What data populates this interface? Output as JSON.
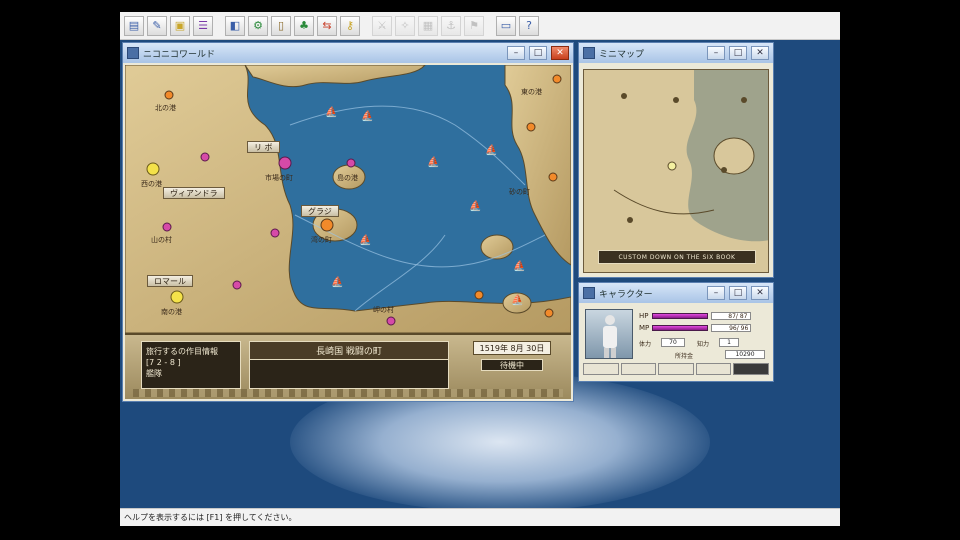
{
  "toolbar": {
    "buttons": [
      {
        "icon": "page-icon",
        "glyph": "▤",
        "color": "#3a5ea8",
        "enabled": true
      },
      {
        "icon": "scroll-icon",
        "glyph": "✎",
        "color": "#3a5ea8",
        "enabled": true
      },
      {
        "icon": "chest-icon",
        "glyph": "▣",
        "color": "#c9a62a",
        "enabled": true
      },
      {
        "icon": "list-icon",
        "glyph": "☰",
        "color": "#7a3aa8",
        "enabled": true
      },
      {
        "icon": "save-icon",
        "glyph": "◧",
        "color": "#3a5ea8",
        "enabled": true
      },
      {
        "icon": "gear-icon",
        "glyph": "⚙",
        "color": "#2a8a3a",
        "enabled": true
      },
      {
        "icon": "book-icon",
        "glyph": "▯",
        "color": "#8a6a2a",
        "enabled": true
      },
      {
        "icon": "tree-icon",
        "glyph": "♣",
        "color": "#2a8a3a",
        "enabled": true
      },
      {
        "icon": "exchange-icon",
        "glyph": "⇆",
        "color": "#c8402a",
        "enabled": true
      },
      {
        "icon": "key-icon",
        "glyph": "⚷",
        "color": "#c9a62a",
        "enabled": true
      },
      {
        "icon": "sword-icon",
        "glyph": "⚔",
        "color": "#888888",
        "enabled": false
      },
      {
        "icon": "compass-icon",
        "glyph": "✧",
        "color": "#888888",
        "enabled": false
      },
      {
        "icon": "map-icon",
        "glyph": "▦",
        "color": "#888888",
        "enabled": false
      },
      {
        "icon": "anchor-icon",
        "glyph": "⚓",
        "color": "#888888",
        "enabled": false
      },
      {
        "icon": "flag-icon",
        "glyph": "⚑",
        "color": "#888888",
        "enabled": false
      },
      {
        "icon": "window-icon",
        "glyph": "▭",
        "color": "#3a5ea8",
        "enabled": true
      },
      {
        "icon": "help-icon",
        "glyph": "?",
        "color": "#3a5ea8",
        "enabled": true
      }
    ]
  },
  "map_window": {
    "title": "ニコニコワールド",
    "city_labels": [
      {
        "id": "c1",
        "text": "北の港"
      },
      {
        "id": "c2",
        "text": "西の港"
      },
      {
        "id": "c3",
        "text": "市場の町"
      },
      {
        "id": "c4",
        "text": "山の村"
      },
      {
        "id": "c5",
        "text": "南の港"
      },
      {
        "id": "c6",
        "text": "東の港"
      },
      {
        "id": "c7",
        "text": "湾の町"
      },
      {
        "id": "c8",
        "text": "島の港"
      },
      {
        "id": "c9",
        "text": "岬の村"
      },
      {
        "id": "c10",
        "text": "砂の町"
      }
    ],
    "banners": [
      {
        "id": "b1",
        "text": "リ ボ"
      },
      {
        "id": "b2",
        "text": "ヴィアンドラ"
      },
      {
        "id": "b3",
        "text": "グラジ"
      },
      {
        "id": "b4",
        "text": "ロマール"
      }
    ],
    "info": {
      "fleet_line1": "旅行するの作目情報",
      "fleet_line2": "[7 2 - 8 ]",
      "fleet_line3": "艦隊",
      "location": "長崎国 戦闘の町",
      "date": "1519年 8月 30日",
      "status": "待機中"
    }
  },
  "mini_window": {
    "title": "ミニマップ",
    "caption": "CUSTOM DOWN ON THE SIX BOOK"
  },
  "char_window": {
    "title": "キャラクター",
    "hp_label": "HP",
    "hp_value": "87/ 87",
    "mp_label": "MP",
    "mp_value": "96/ 96",
    "attr1_label": "体力",
    "attr1_value": "70",
    "attr2_label": "知力",
    "attr2_value": "1",
    "money_label": "所持金",
    "money_value": "10290"
  },
  "statusbar": {
    "text": "ヘルプを表示するには [F1] を押してください。"
  }
}
